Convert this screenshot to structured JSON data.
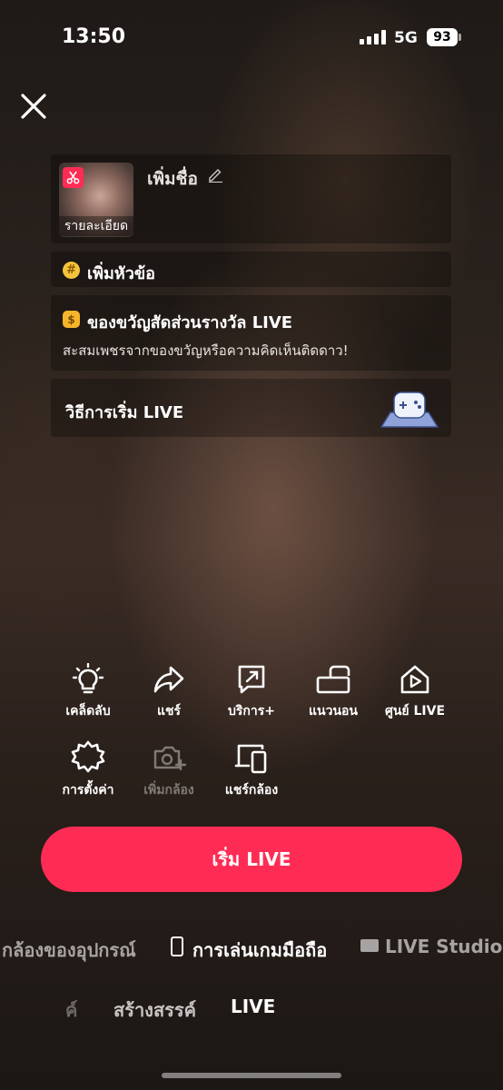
{
  "status": {
    "time": "13:50",
    "network": "5G",
    "battery": "93"
  },
  "title_card": {
    "thumb_label": "รายละเอียด",
    "title_placeholder": "เพิ่มชื่อ"
  },
  "topic": {
    "label": "เพิ่มหัวข้อ",
    "icon": "hashtag-icon"
  },
  "gift": {
    "title": "ของขวัญสัดส่วนรางวัล LIVE",
    "subtitle": "สะสมเพชรจากของขวัญหรือความคิดเห็นติดดาว!",
    "icon": "coin-icon"
  },
  "howto": {
    "label": "วิธีการเริ่ม LIVE"
  },
  "tools": {
    "tips": "เคล็ดลับ",
    "share": "แชร์",
    "services": "บริการ+",
    "landscape": "แนวนอน",
    "live_center": "ศูนย์ LIVE",
    "settings": "การตั้งค่า",
    "add_camera": "เพิ่มกล้อง",
    "share_camera": "แชร์กล้อง"
  },
  "start_button": "เริ่ม LIVE",
  "modes": {
    "device_camera": "กล้องของอุปกรณ์",
    "mobile_gaming": "การเล่นเกมมือถือ",
    "live_studio": "LIVE Studio"
  },
  "bottom_tabs": {
    "partial": "ค์",
    "create": "สร้างสรรค์",
    "live": "LIVE"
  },
  "colors": {
    "accent": "#fe2c55",
    "coin": "#f5b42a",
    "topic": "#f5c33b"
  }
}
